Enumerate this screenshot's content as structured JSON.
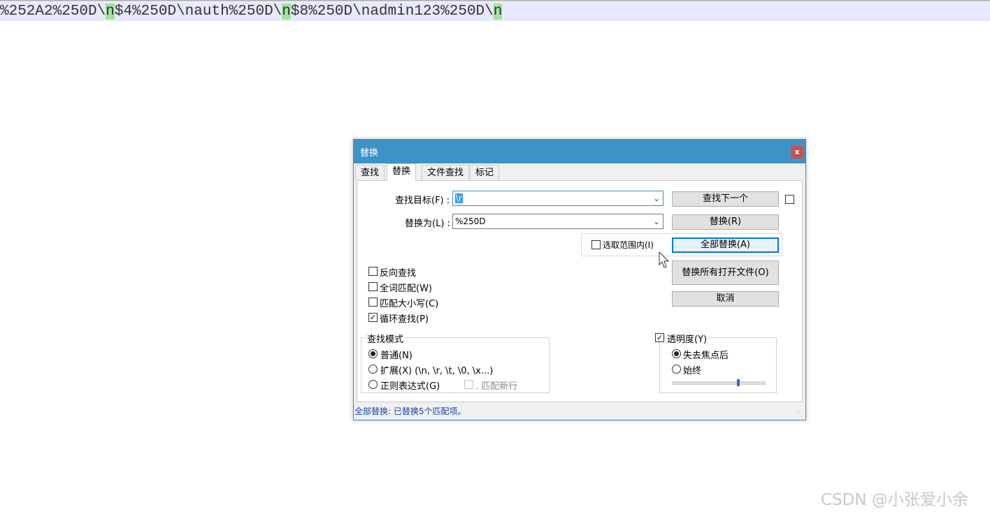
{
  "editor": {
    "segments": [
      {
        "text": "%252A2%250D\\",
        "highlight": false
      },
      {
        "text": "n",
        "highlight": true
      },
      {
        "text": "$4%250D\\nauth%250D\\",
        "highlight": false
      },
      {
        "text": "n",
        "highlight": true
      },
      {
        "text": "$8%250D\\nadmin123%250D\\",
        "highlight": false
      },
      {
        "text": "n",
        "highlight": true
      }
    ]
  },
  "dialog": {
    "title": "替换",
    "close_label": "x",
    "tabs": [
      "查找",
      "替换",
      "文件查找",
      "标记"
    ],
    "find_label": "查找目标(F) :",
    "find_value": "\\r",
    "replace_label": "替换为(L) :",
    "replace_value": "%250D",
    "in_selection_label": "选取范围内(I)",
    "buttons": {
      "find_next": "查找下一个",
      "replace": "替换(R)",
      "replace_all": "全部替换(A)",
      "replace_all_open": "替换所有打开文件(O)",
      "cancel": "取消"
    },
    "options": [
      {
        "label": "反向查找",
        "checked": false
      },
      {
        "label": "全词匹配(W)",
        "checked": false
      },
      {
        "label": "匹配大小写(C)",
        "checked": false
      },
      {
        "label": "循环查找(P)",
        "checked": true
      }
    ],
    "search_mode": {
      "title": "查找模式",
      "normal": "普通(N)",
      "extended": "扩展(X) (\\n, \\r, \\t, \\0, \\x...)",
      "regex": "正则表达式(G)",
      "dot_newline": ". 匹配新行",
      "selected": "normal"
    },
    "transparency": {
      "title": "透明度(Y)",
      "checked": true,
      "on_lose_focus": "失去焦点后",
      "always": "始终",
      "selected": "on_lose_focus",
      "level": 0.72
    },
    "status": "全部替换: 已替换5个匹配项。"
  },
  "watermark": "CSDN @小张爱小余"
}
